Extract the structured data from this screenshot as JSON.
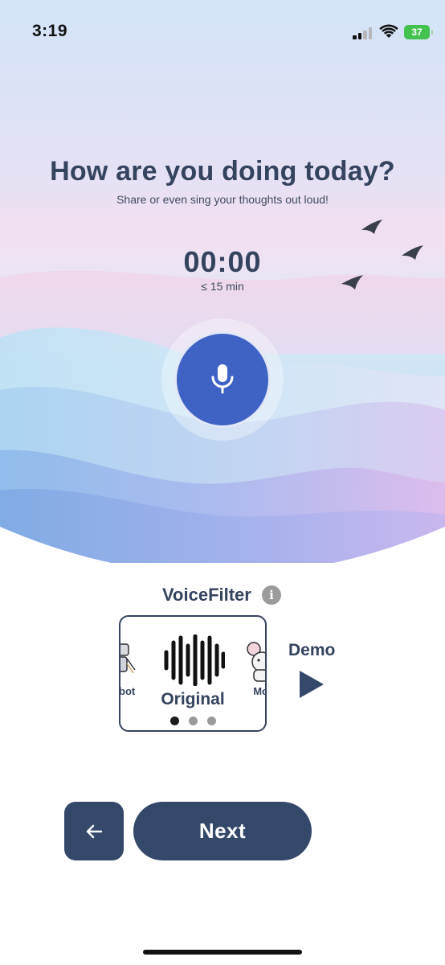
{
  "status_bar": {
    "time": "3:19",
    "battery": "37"
  },
  "prompt": {
    "title": "How are you doing today?",
    "subtitle": "Share or even sing your thoughts out loud!"
  },
  "recorder": {
    "timer": "00:00",
    "limit": "≤ 15 min",
    "mic_icon": "microphone-icon"
  },
  "voice_filter": {
    "title": "VoiceFilter",
    "info_icon": "i",
    "selected": "Original",
    "prev_partial_label": "bot",
    "next_partial_label": "Mo",
    "page_count": 3,
    "page_index": 0
  },
  "demo": {
    "label": "Demo",
    "icon": "play-icon"
  },
  "navigation": {
    "back_icon": "arrow-left-icon",
    "next_label": "Next"
  },
  "colors": {
    "primary": "#34496a",
    "mic": "#3f63c4",
    "text": "#34435e",
    "battery": "#43c24f"
  }
}
